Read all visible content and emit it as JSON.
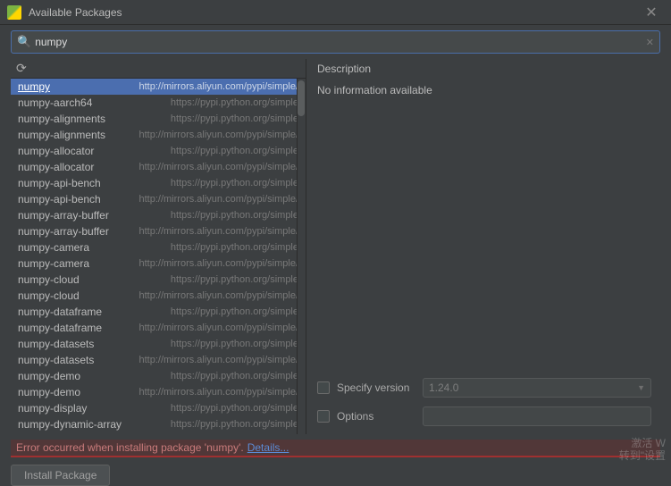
{
  "window": {
    "title": "Available Packages"
  },
  "search": {
    "value": "numpy",
    "placeholder": ""
  },
  "description": {
    "label": "Description",
    "text": "No information available"
  },
  "packages": [
    {
      "name": "numpy",
      "src": "http://mirrors.aliyun.com/pypi/simple/",
      "selected": true
    },
    {
      "name": "numpy-aarch64",
      "src": "https://pypi.python.org/simple"
    },
    {
      "name": "numpy-alignments",
      "src": "https://pypi.python.org/simple"
    },
    {
      "name": "numpy-alignments",
      "src": "http://mirrors.aliyun.com/pypi/simple/"
    },
    {
      "name": "numpy-allocator",
      "src": "https://pypi.python.org/simple"
    },
    {
      "name": "numpy-allocator",
      "src": "http://mirrors.aliyun.com/pypi/simple/"
    },
    {
      "name": "numpy-api-bench",
      "src": "https://pypi.python.org/simple"
    },
    {
      "name": "numpy-api-bench",
      "src": "http://mirrors.aliyun.com/pypi/simple/"
    },
    {
      "name": "numpy-array-buffer",
      "src": "https://pypi.python.org/simple"
    },
    {
      "name": "numpy-array-buffer",
      "src": "http://mirrors.aliyun.com/pypi/simple/"
    },
    {
      "name": "numpy-camera",
      "src": "https://pypi.python.org/simple"
    },
    {
      "name": "numpy-camera",
      "src": "http://mirrors.aliyun.com/pypi/simple/"
    },
    {
      "name": "numpy-cloud",
      "src": "https://pypi.python.org/simple"
    },
    {
      "name": "numpy-cloud",
      "src": "http://mirrors.aliyun.com/pypi/simple/"
    },
    {
      "name": "numpy-dataframe",
      "src": "https://pypi.python.org/simple"
    },
    {
      "name": "numpy-dataframe",
      "src": "http://mirrors.aliyun.com/pypi/simple/"
    },
    {
      "name": "numpy-datasets",
      "src": "https://pypi.python.org/simple"
    },
    {
      "name": "numpy-datasets",
      "src": "http://mirrors.aliyun.com/pypi/simple/"
    },
    {
      "name": "numpy-demo",
      "src": "https://pypi.python.org/simple"
    },
    {
      "name": "numpy-demo",
      "src": "http://mirrors.aliyun.com/pypi/simple/"
    },
    {
      "name": "numpy-display",
      "src": "https://pypi.python.org/simple"
    },
    {
      "name": "numpy-dynamic-array",
      "src": "https://pypi.python.org/simple"
    }
  ],
  "options": {
    "specify_version_label": "Specify version",
    "version_value": "1.24.0",
    "options_label": "Options",
    "options_value": ""
  },
  "error": {
    "message": "Error occurred when installing package 'numpy'.",
    "details_label": "Details..."
  },
  "buttons": {
    "install": "Install Package"
  },
  "watermark": {
    "line1": "激活 W",
    "line2": "转到\"设置"
  }
}
